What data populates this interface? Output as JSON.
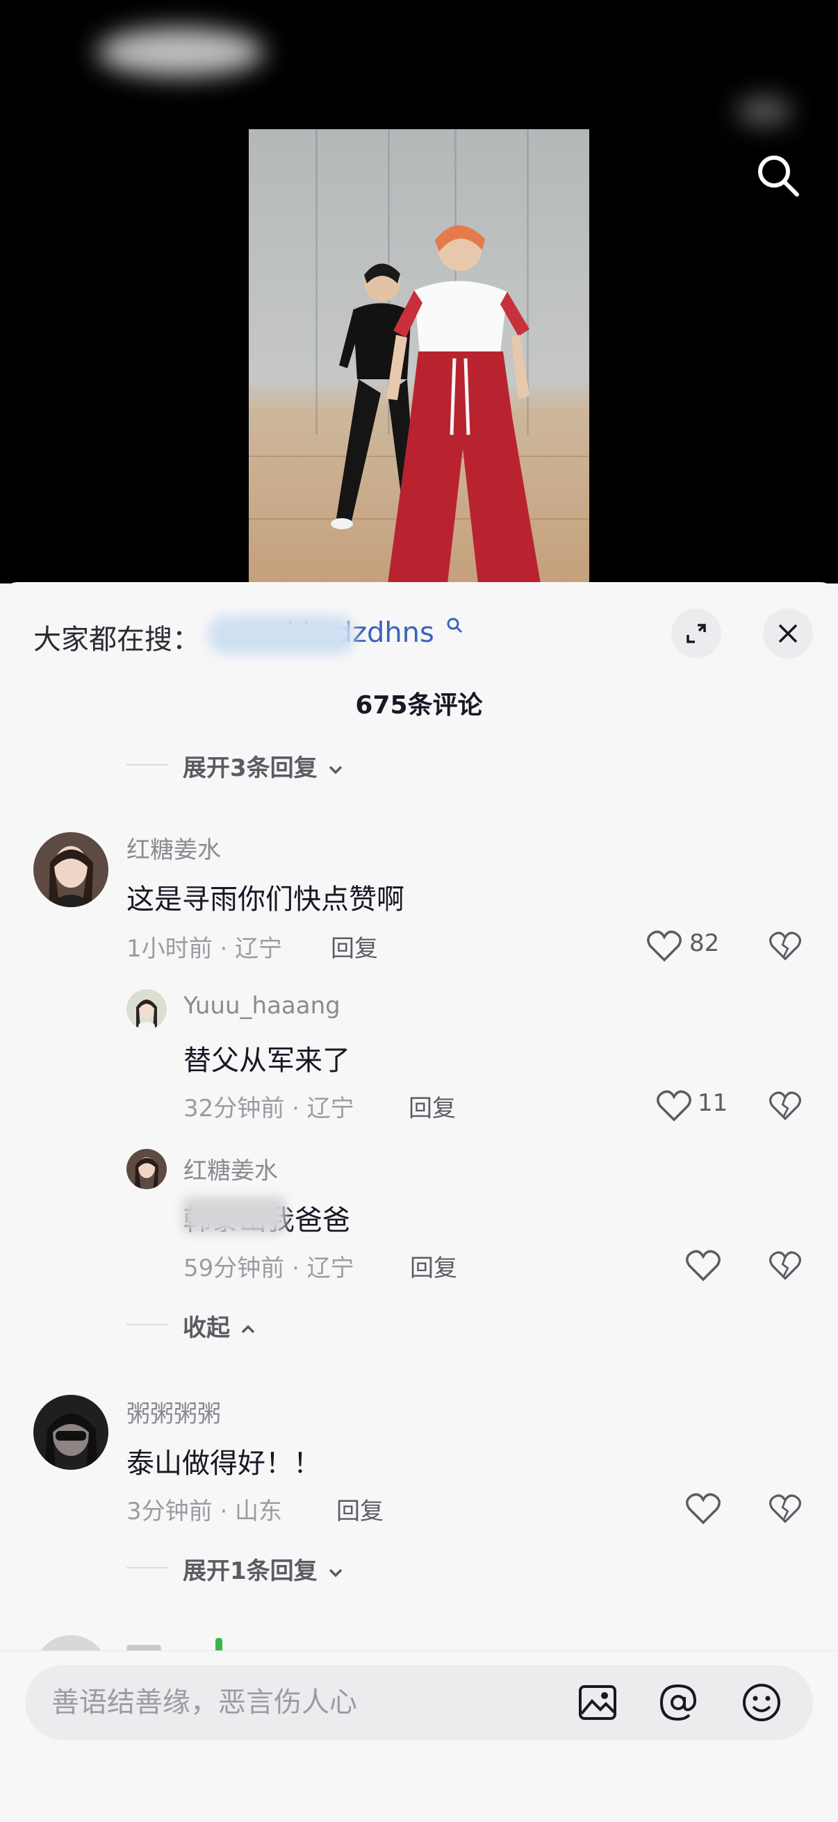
{
  "header": {
    "search_icon": "search-icon"
  },
  "trending": {
    "label": "大家都在搜：",
    "term": "kbzdzdhns",
    "icons": {
      "expand": "expand-icon",
      "close": "close-icon"
    }
  },
  "comment_count": "675条评论",
  "top_toggle": "展开3条回复",
  "comments": [
    {
      "username": "红糖姜水",
      "text": "这是寻雨你们快点赞啊",
      "meta": "1小时前 · 辽宁",
      "reply": "回复",
      "likes": "82",
      "replies": [
        {
          "username": "Yuuu_haaang",
          "text": "替父从军来了",
          "meta": "32分钟前 · 辽宁",
          "reply": "回复",
          "likes": "11"
        },
        {
          "username": "红糖姜水",
          "text": "韩泰山我爸爸",
          "meta": "59分钟前 · 辽宁",
          "reply": "回复",
          "likes": ""
        }
      ],
      "collapse": "收起"
    },
    {
      "username": "粥粥粥粥",
      "text": "泰山做得好！！",
      "meta": "3分钟前 · 山东",
      "reply": "回复",
      "likes": "",
      "expand": "展开1条回复"
    }
  ],
  "input": {
    "placeholder": "善语结善缘，恶言伤人心",
    "icons": [
      "image-icon",
      "at-icon",
      "emoji-icon"
    ]
  }
}
